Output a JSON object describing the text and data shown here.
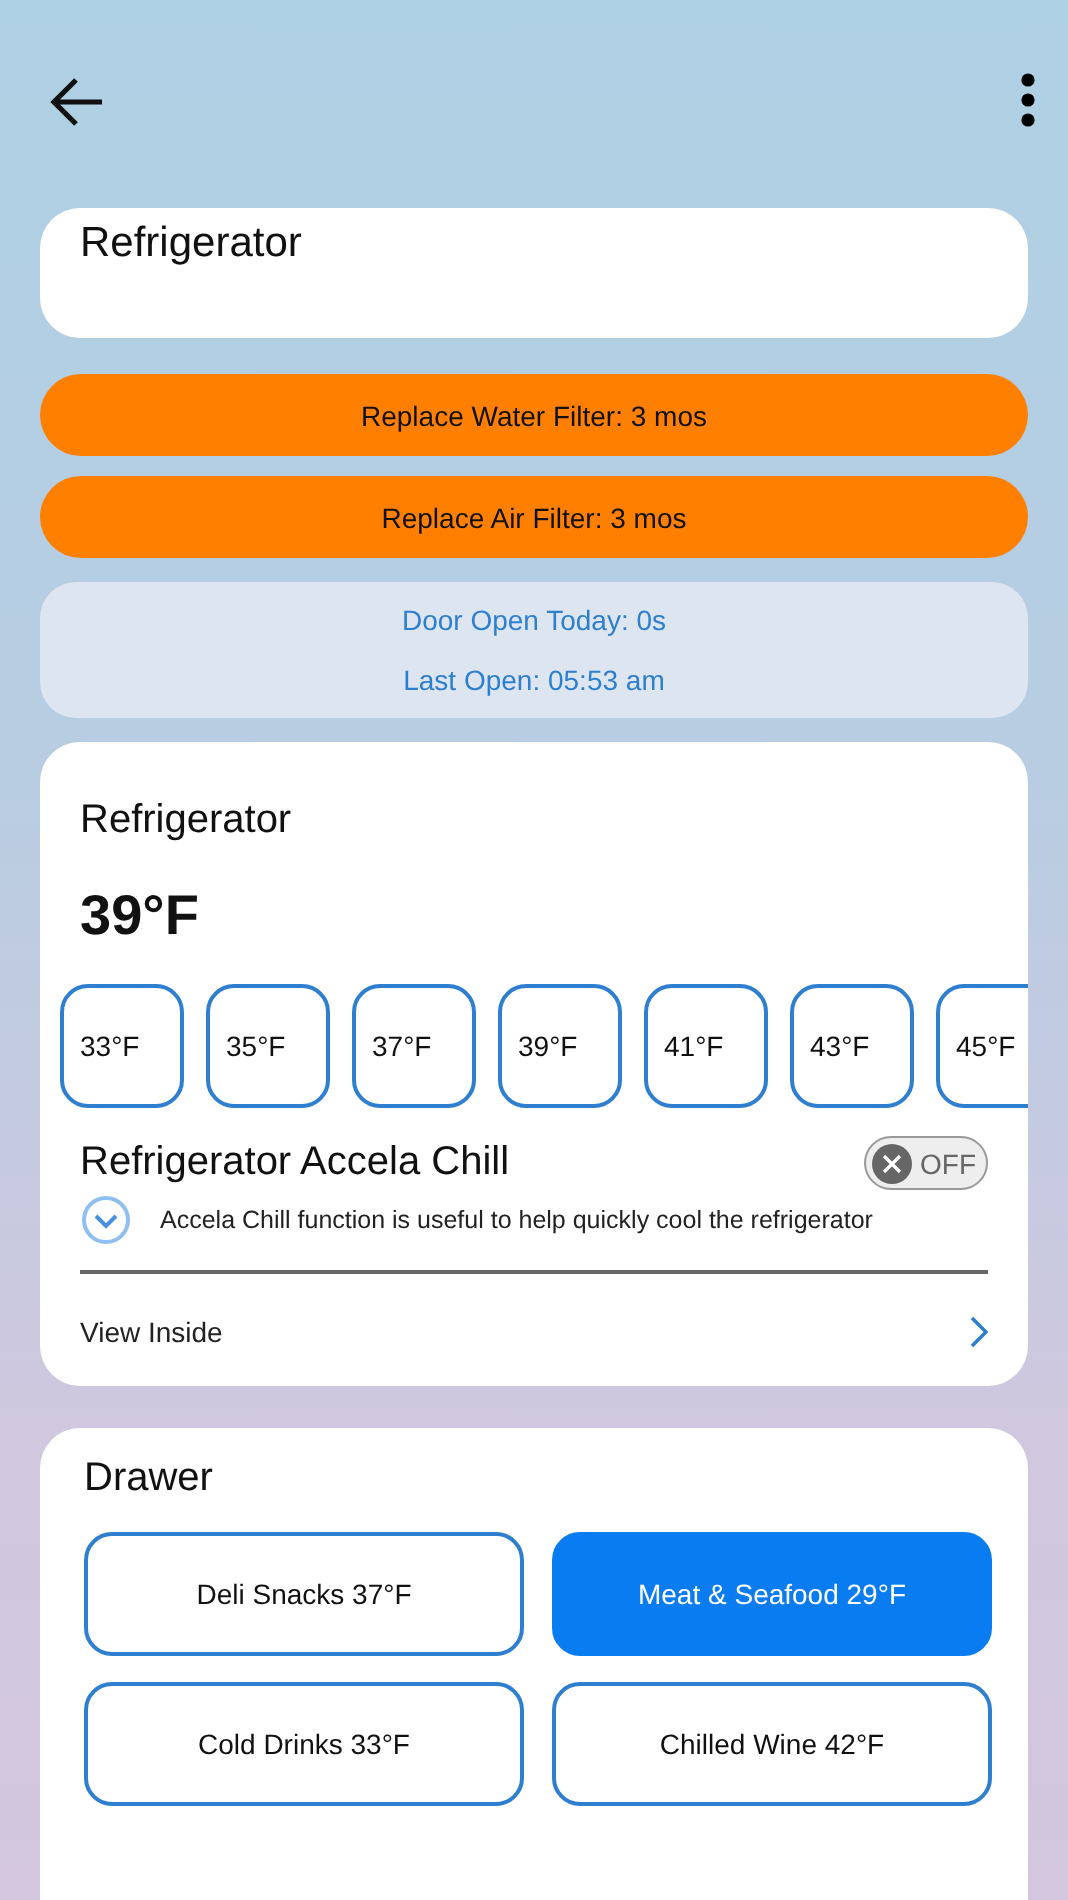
{
  "header": {
    "title": "Refrigerator"
  },
  "alerts": [
    "Replace Water Filter: 3 mos",
    "Replace Air Filter: 3 mos"
  ],
  "door": {
    "lines": [
      "Door Open Today: 0s",
      "Last Open: 05:53 am"
    ]
  },
  "fridge": {
    "title": "Refrigerator",
    "temperature": "39°F",
    "options": [
      {
        "label": "33°F",
        "selected": false
      },
      {
        "label": "35°F",
        "selected": false
      },
      {
        "label": "37°F",
        "selected": false
      },
      {
        "label": "39°F",
        "selected": false
      },
      {
        "label": "41°F",
        "selected": false
      },
      {
        "label": "43°F",
        "selected": false
      },
      {
        "label": "45°F",
        "selected": false
      }
    ],
    "accela": {
      "title": "Refrigerator Accela Chill",
      "on": false,
      "toggle_label": "OFF",
      "description": "Accela Chill function is useful to help quickly cool the refrigerator",
      "expanded": false
    },
    "link": "View Inside"
  },
  "drawer": {
    "title": "Drawer",
    "modes": [
      {
        "label": "Deli Snacks 37°F",
        "selected": false
      },
      {
        "label": "Meat & Seafood 29°F",
        "selected": true
      },
      {
        "label": "Cold Drinks 33°F",
        "selected": false
      },
      {
        "label": "Chilled Wine 42°F",
        "selected": false
      }
    ]
  }
}
